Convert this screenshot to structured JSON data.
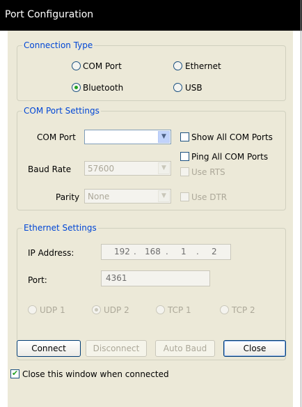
{
  "window": {
    "title": "Port Configuration"
  },
  "connection_type": {
    "legend": "Connection Type",
    "options": [
      {
        "label": "COM Port",
        "selected": false
      },
      {
        "label": "Ethernet",
        "selected": false
      },
      {
        "label": "Bluetooth",
        "selected": true
      },
      {
        "label": "USB",
        "selected": false
      }
    ]
  },
  "com_settings": {
    "legend": "COM Port Settings",
    "com_port": {
      "label": "COM Port",
      "value": ""
    },
    "baud_rate": {
      "label": "Baud Rate",
      "value": "57600",
      "enabled": false
    },
    "parity": {
      "label": "Parity",
      "value": "None",
      "enabled": false
    },
    "show_all": {
      "label": "Show All COM Ports",
      "checked": false
    },
    "ping_all": {
      "label": "Ping All COM Ports",
      "checked": false
    },
    "use_rts": {
      "label": "Use RTS",
      "checked": false,
      "enabled": false
    },
    "use_dtr": {
      "label": "Use DTR",
      "checked": false,
      "enabled": false
    }
  },
  "ethernet_settings": {
    "legend": "Ethernet Settings",
    "ip_label": "IP Address:",
    "ip": [
      "192",
      "168",
      "1",
      "2"
    ],
    "ip_dot": ".",
    "port_label": "Port:",
    "port_value": "4361",
    "protocols": [
      {
        "label": "UDP 1",
        "selected": false
      },
      {
        "label": "UDP 2",
        "selected": true
      },
      {
        "label": "TCP 1",
        "selected": false
      },
      {
        "label": "TCP 2",
        "selected": false
      }
    ]
  },
  "buttons": {
    "connect": "Connect",
    "disconnect": "Disconnect",
    "auto_baud": "Auto Baud",
    "close": "Close"
  },
  "close_on_connect": {
    "label": "Close this window when connected",
    "checked": true
  },
  "icons": {
    "dropdown": "▼",
    "check": "✔"
  }
}
